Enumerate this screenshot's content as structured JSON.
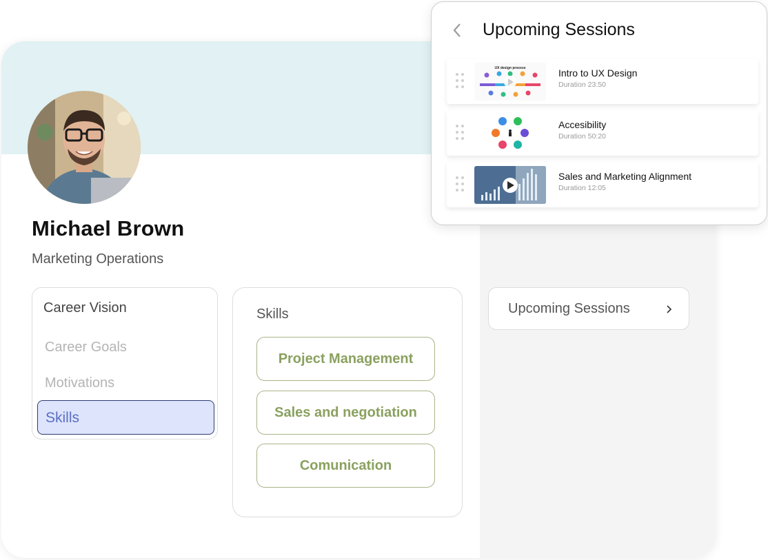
{
  "profile": {
    "name": "Michael Brown",
    "role": "Marketing Operations"
  },
  "career_menu": {
    "title": "Career Vision",
    "items": [
      {
        "label": "Career Goals",
        "active": false
      },
      {
        "label": "Motivations",
        "active": false
      },
      {
        "label": "Skills",
        "active": true
      }
    ]
  },
  "skills": {
    "title": "Skills",
    "chips": [
      "Project Management",
      "Sales and negotiation",
      "Comunication"
    ]
  },
  "sessions_button": {
    "label": "Upcoming Sessions"
  },
  "popup": {
    "title": "Upcoming Sessions",
    "sessions": [
      {
        "title": "Intro to UX Design",
        "duration": "Duration 23:50",
        "thumb_text": "UX design process"
      },
      {
        "title": "Accesibility",
        "duration": "Duration 50:20"
      },
      {
        "title": "Sales and Marketing Alignment",
        "duration": "Duration 12:05"
      }
    ]
  },
  "colors": {
    "banner": "#e1f1f4",
    "skill_accent": "#8aa15f",
    "active_bg": "#dde4fc",
    "active_border": "#2d3a70",
    "active_text": "#5b6fc2"
  }
}
